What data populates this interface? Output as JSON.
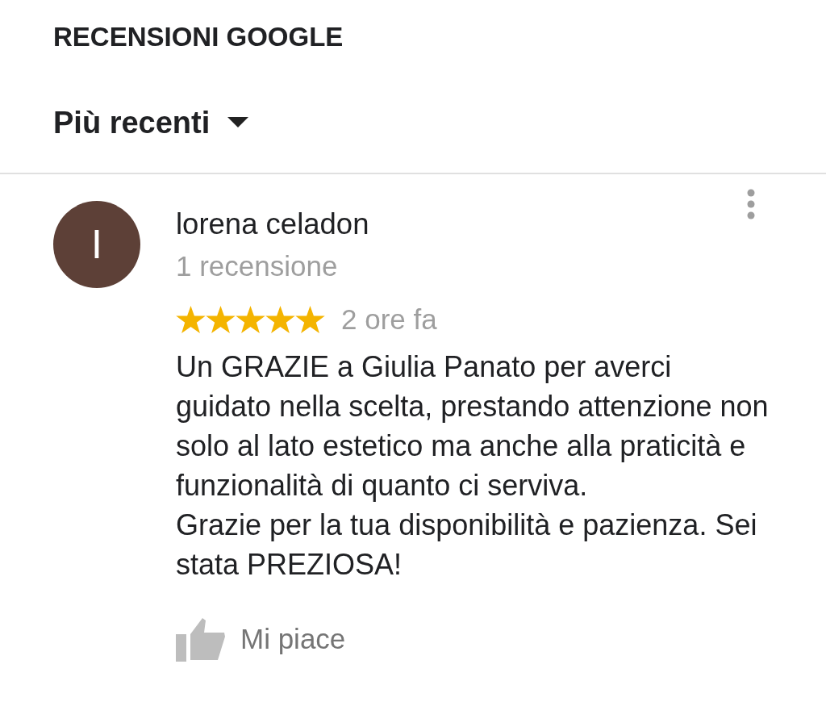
{
  "header": {
    "title": "RECENSIONI GOOGLE"
  },
  "sort": {
    "label": "Più recenti"
  },
  "review": {
    "avatar_letter": "I",
    "author": "lorena celadon",
    "review_count": "1 recensione",
    "stars": 5,
    "time": "2 ore fa",
    "text": "Un GRAZIE a Giulia Panato per averci guidato nella scelta, prestando attenzione non solo al lato estetico ma anche alla praticità e funzionalità di quanto ci serviva.\nGrazie per la tua disponibilità e pazienza. Sei stata PREZIOSA!",
    "like_label": "Mi piace"
  }
}
